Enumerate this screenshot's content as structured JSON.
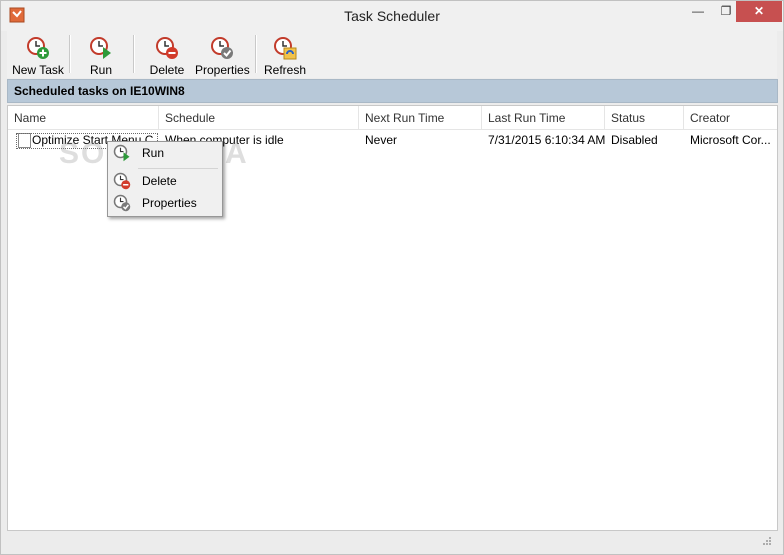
{
  "window": {
    "title": "Task Scheduler",
    "minimize": "—",
    "maximize": "❐",
    "close": "✕"
  },
  "toolbar": {
    "new_task": "New Task",
    "run": "Run",
    "delete": "Delete",
    "properties": "Properties",
    "refresh": "Refresh"
  },
  "header": "Scheduled tasks on IE10WIN8",
  "columns": [
    "Name",
    "Schedule",
    "Next Run Time",
    "Last Run Time",
    "Status",
    "Creator"
  ],
  "rows": [
    {
      "name": "Optimize Start Menu C",
      "schedule": "When computer is idle",
      "next_run": "Never",
      "last_run": "7/31/2015 6:10:34 AM",
      "status": "Disabled",
      "creator": "Microsoft Cor..."
    }
  ],
  "context_menu": {
    "run": "Run",
    "delete": "Delete",
    "properties": "Properties"
  },
  "watermark": "SOFTPEDIA",
  "icons": {
    "app": "task-scheduler-icon",
    "new_task": "clock-add-icon",
    "run": "clock-run-icon",
    "delete": "clock-delete-icon",
    "properties": "clock-properties-icon",
    "refresh": "refresh-icon"
  },
  "colors": {
    "header_bar": "#b7c8d8",
    "close_button": "#c75050",
    "accent_green": "#2e9a3a",
    "accent_red": "#d23b2b"
  }
}
